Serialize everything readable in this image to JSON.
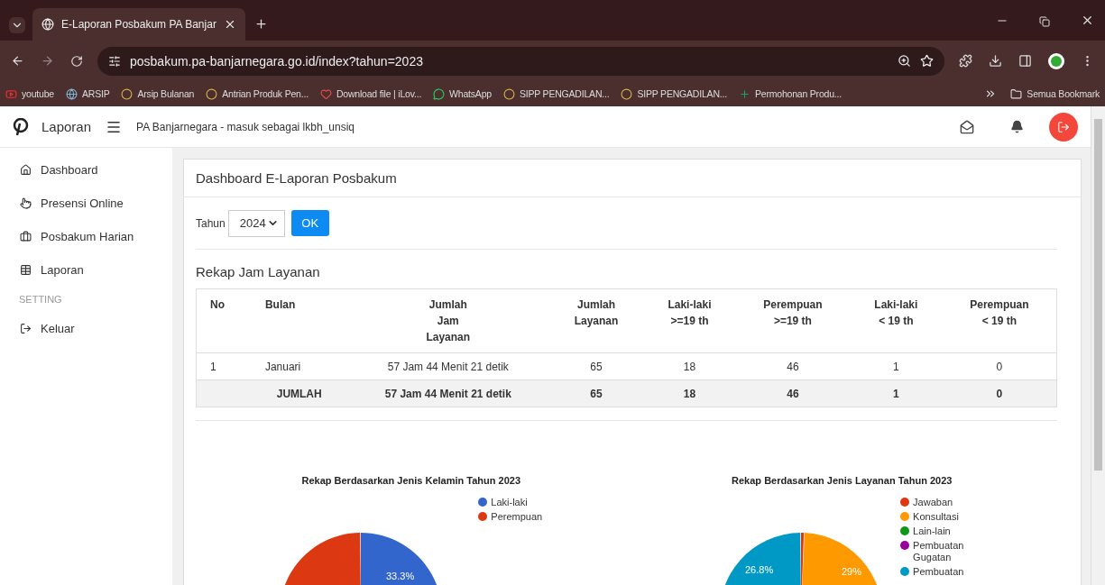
{
  "browser": {
    "tabs": [
      {
        "title": "E-Laporan Posbakum PA Banjar",
        "selected": true
      }
    ],
    "url": "posbakum.pa-banjarnegara.go.id/index?tahun=2023",
    "bookmarks": [
      {
        "label": "youtube"
      },
      {
        "label": "ARSIP"
      },
      {
        "label": "Arsip Bulanan"
      },
      {
        "label": "Antrian Produk Pen..."
      },
      {
        "label": "Download file | iLov..."
      },
      {
        "label": "WhatsApp"
      },
      {
        "label": "SIPP PENGADILAN..."
      },
      {
        "label": "SIPP PENGADILAN..."
      },
      {
        "label": "Permohonan Produ..."
      }
    ],
    "all_bookmarks": "Semua Bookmark"
  },
  "header": {
    "brand": "Laporan",
    "subtitle": "PA Banjarnegara - masuk sebagai lkbh_unsiq"
  },
  "sidebar": [
    {
      "kind": "item",
      "label": "Dashboard"
    },
    {
      "kind": "item",
      "label": "Presensi Online"
    },
    {
      "kind": "item",
      "label": "Posbakum Harian"
    },
    {
      "kind": "item",
      "label": "Laporan"
    },
    {
      "kind": "heading",
      "label": "SETTING"
    },
    {
      "kind": "item",
      "label": "Keluar"
    }
  ],
  "card": {
    "title": "Dashboard E-Laporan Posbakum",
    "year_label": "Tahun",
    "year": "2024",
    "ok": "OK"
  },
  "table": {
    "title": "Rekap Jam Layanan",
    "columns": [
      "No",
      "Bulan",
      "Jumlah\nJam\nLayanan",
      "Jumlah\nLayanan",
      "Laki-laki\n>=19 th",
      "Perempuan\n>=19 th",
      "Laki-laki\n< 19 th",
      "Perempuan\n< 19 th"
    ],
    "rows": [
      {
        "kind": "data",
        "cells": [
          "1",
          "Januari",
          "57 Jam 44 Menit 21 detik",
          "65",
          "18",
          "46",
          "1",
          "0"
        ]
      },
      {
        "kind": "total",
        "cells": [
          "",
          "JUMLAH",
          "57 Jam 44 Menit 21 detik",
          "65",
          "18",
          "46",
          "1",
          "0"
        ]
      }
    ]
  },
  "pies": [
    {
      "title": "Rekap Berdasarkan Jenis Kelamin Tahun 2023",
      "legend": [
        {
          "label": "Laki-laki",
          "color": "#3366cc"
        },
        {
          "label": "Perempuan",
          "color": "#dc3912"
        }
      ],
      "slice_labels": [
        "33.3%"
      ]
    },
    {
      "title": "Rekap Berdasarkan Jenis Layanan Tahun 2023",
      "legend": [
        {
          "label": "Jawaban",
          "color": "#dc3912"
        },
        {
          "label": "Konsultasi",
          "color": "#ff9900"
        },
        {
          "label": "Lain-lain",
          "color": "#109618"
        },
        {
          "label": "Pembuatan\nGugatan",
          "color": "#990099"
        },
        {
          "label": "Pembuatan",
          "color": "#0099c6"
        }
      ],
      "slice_labels": [
        "26.8%",
        "29%"
      ]
    }
  ]
}
